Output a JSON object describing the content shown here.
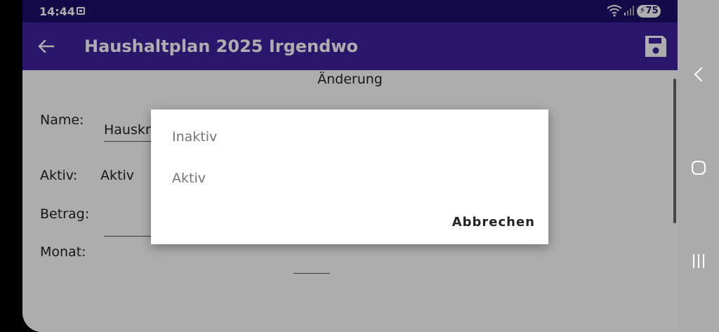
{
  "status_bar": {
    "time": "14:44",
    "battery": "75"
  },
  "app_bar": {
    "title": "Haushaltplan 2025 Irgendwo"
  },
  "form": {
    "heading": "Änderung",
    "name_label": "Name:",
    "name_value": "Hauskre",
    "aktiv_label": "Aktiv:",
    "aktiv_value": "Aktiv",
    "betrag_label": "Betrag:",
    "monat_label": "Monat:"
  },
  "dialog": {
    "options": [
      "Inaktiv",
      "Aktiv"
    ],
    "cancel_label": "Abbrechen"
  },
  "colors": {
    "status_bar": "#1e0f6b",
    "app_bar": "#3e229f",
    "nav_bar": "#ababab"
  }
}
